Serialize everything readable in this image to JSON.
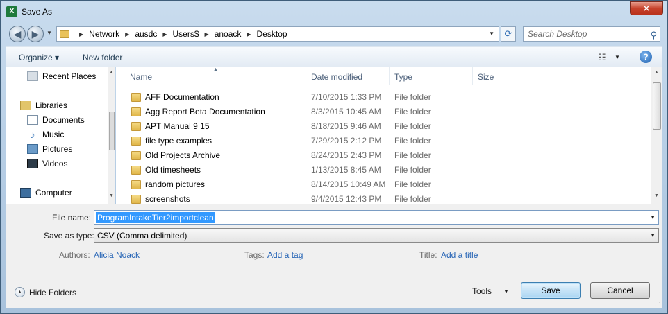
{
  "window": {
    "title": "Save As",
    "app_icon_label": "X",
    "close_glyph": "✕"
  },
  "nav": {
    "back_glyph": "◀",
    "forward_glyph": "▶",
    "dropdown_glyph": "▼",
    "breadcrumbs": [
      "Network",
      "ausdc",
      "Users$",
      "anoack",
      "Desktop"
    ],
    "breadcrumb_separator": "▶",
    "refresh_glyph": "⟳",
    "search_placeholder": "Search Desktop",
    "search_icon_glyph": "⚲"
  },
  "toolbar": {
    "organize": "Organize ▾",
    "new_folder": "New folder",
    "view_glyph": "☷",
    "view_drop": "▼",
    "help_glyph": "?"
  },
  "sidebar": {
    "items": [
      {
        "label": "Recent Places",
        "icon": "recent-places-icon"
      },
      {
        "label": "Libraries",
        "icon": "libraries-icon"
      },
      {
        "label": "Documents",
        "icon": "documents-icon"
      },
      {
        "label": "Music",
        "icon": "music-icon",
        "glyph": "♪"
      },
      {
        "label": "Pictures",
        "icon": "pictures-icon"
      },
      {
        "label": "Videos",
        "icon": "videos-icon"
      },
      {
        "label": "Computer",
        "icon": "computer-icon"
      }
    ],
    "scroll_up": "▲",
    "scroll_down": "▼"
  },
  "files": {
    "columns": [
      "Name",
      "Date modified",
      "Type",
      "Size"
    ],
    "sort_glyph": "▲",
    "rows": [
      {
        "name": "AFF Documentation",
        "date": "7/10/2015 1:33 PM",
        "type": "File folder"
      },
      {
        "name": "Agg Report Beta Documentation",
        "date": "8/3/2015 10:45 AM",
        "type": "File folder"
      },
      {
        "name": "APT Manual 9 15",
        "date": "8/18/2015 9:46 AM",
        "type": "File folder"
      },
      {
        "name": "file type examples",
        "date": "7/29/2015 2:12 PM",
        "type": "File folder"
      },
      {
        "name": "Old Projects Archive",
        "date": "8/24/2015 2:43 PM",
        "type": "File folder"
      },
      {
        "name": "Old timesheets",
        "date": "1/13/2015 8:45 AM",
        "type": "File folder"
      },
      {
        "name": "random pictures",
        "date": "8/14/2015 10:49 AM",
        "type": "File folder"
      },
      {
        "name": "screenshots",
        "date": "9/4/2015 12:43 PM",
        "type": "File folder"
      }
    ],
    "scroll_up": "▲",
    "scroll_down": "▼"
  },
  "form": {
    "file_name_label": "File name:",
    "file_name_value": "ProgramIntakeTier2importclean",
    "save_as_type_label": "Save as type:",
    "save_as_type_value": "CSV (Comma delimited)",
    "dropdown_glyph": "▼",
    "authors_label": "Authors:",
    "authors_value": "Alicia Noack",
    "tags_label": "Tags:",
    "tags_value": "Add a tag",
    "title_label": "Title:",
    "title_value": "Add a title"
  },
  "footer": {
    "hide_folders": "Hide Folders",
    "hide_glyph": "▲",
    "tools": "Tools",
    "tools_drop": "▼",
    "save": "Save",
    "cancel": "Cancel",
    "grip": "⋰"
  }
}
